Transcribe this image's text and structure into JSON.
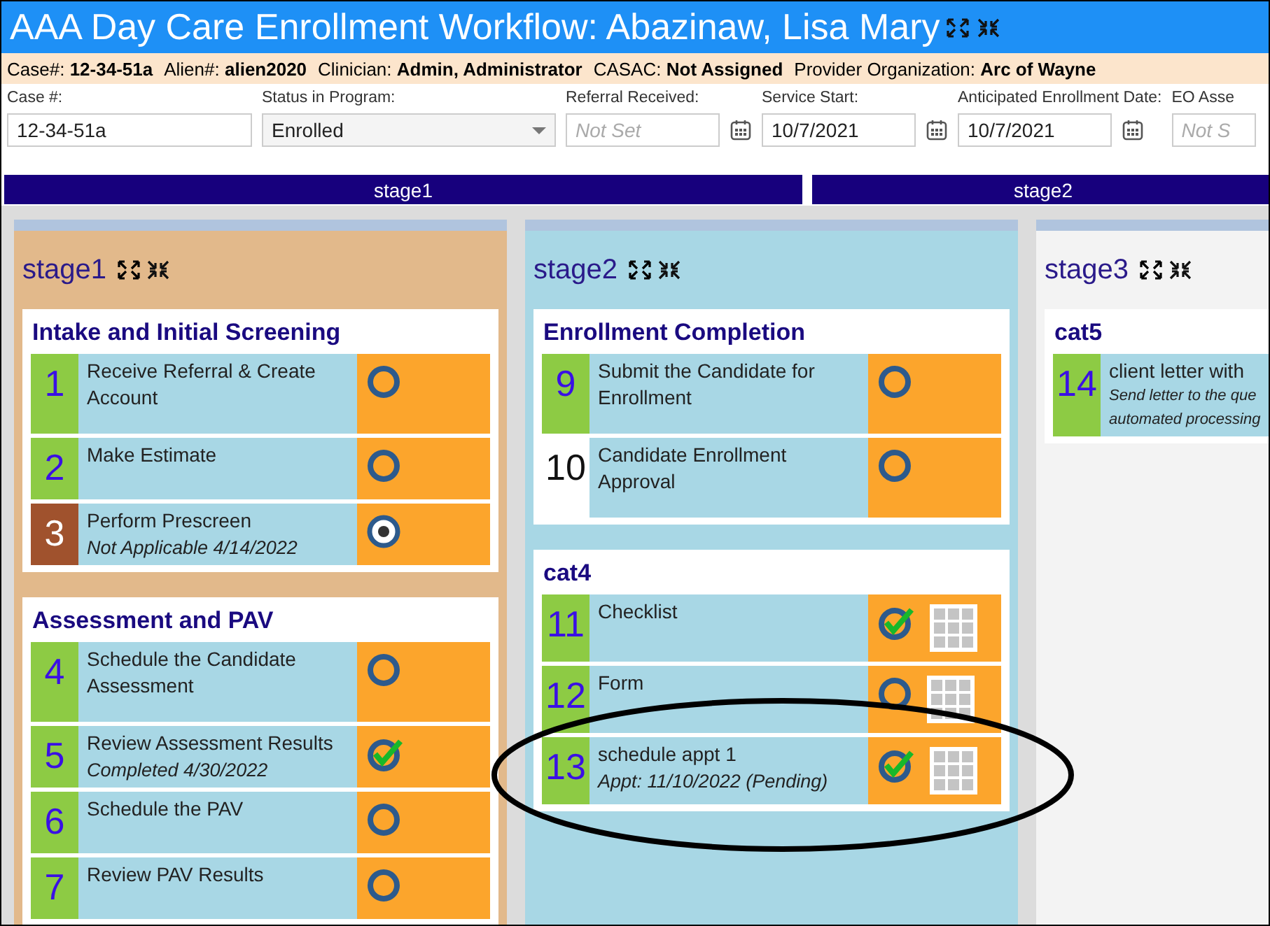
{
  "window": {
    "title": "AAA Day Care Enrollment Workflow: Abazinaw, Lisa Mary"
  },
  "info_bar": [
    {
      "label": "Case#:",
      "value": "12-34-51a"
    },
    {
      "label": "Alien#:",
      "value": "alien2020"
    },
    {
      "label": "Clinician:",
      "value": "Admin, Administrator"
    },
    {
      "label": "CASAC:",
      "value": "Not Assigned"
    },
    {
      "label": "Provider Organization:",
      "value": "Arc of Wayne"
    }
  ],
  "fields": [
    {
      "kind": "text",
      "label": "Case #:",
      "value": "12-34-51a"
    },
    {
      "kind": "dropdown",
      "label": "Status in Program:",
      "value": "Enrolled"
    },
    {
      "kind": "date",
      "label": "Referral Received:",
      "placeholder": "Not Set"
    },
    {
      "kind": "date",
      "label": "Service Start:",
      "value": "10/7/2021"
    },
    {
      "kind": "date",
      "label": "Anticipated Enrollment Date:",
      "value": "10/7/2021"
    },
    {
      "kind": "text",
      "label": "EO Asse",
      "placeholder": "Not S"
    }
  ],
  "stage_bars": [
    {
      "label": "stage1"
    },
    {
      "label": "stage2"
    }
  ],
  "stages": [
    {
      "title": "stage1",
      "color": "#e2b98b",
      "categories": [
        {
          "title": "Intake and Initial Screening",
          "tasks": [
            {
              "number": "1",
              "color": "#8dcb44",
              "title": "Receive Referral & Create Account",
              "kind": "open",
              "grid": false
            },
            {
              "number": "2",
              "color": "#8dcb44",
              "title": "Make Estimate",
              "kind": "open",
              "grid": false
            },
            {
              "number": "3",
              "color": "#a0522d",
              "title": "Perform Prescreen",
              "note": "Not Applicable 4/14/2022",
              "kind": "na",
              "grid": false
            }
          ]
        },
        {
          "title": "Assessment and PAV",
          "tasks": [
            {
              "number": "4",
              "color": "#8dcb44",
              "title": "Schedule the Candidate Assessment",
              "kind": "open",
              "grid": false
            },
            {
              "number": "5",
              "color": "#8dcb44",
              "title": "Review Assessment Results",
              "note": "Completed 4/30/2022",
              "kind": "done",
              "grid": false
            },
            {
              "number": "6",
              "color": "#8dcb44",
              "title": "Schedule the PAV",
              "kind": "open",
              "grid": false
            },
            {
              "number": "7",
              "color": "#8dcb44",
              "title": "Review PAV Results",
              "kind": "open",
              "grid": false
            }
          ]
        }
      ]
    },
    {
      "title": "stage2",
      "color": "#a8d7e5",
      "categories": [
        {
          "title": "Enrollment Completion",
          "tasks": [
            {
              "number": "9",
              "color": "#8dcb44",
              "title": "Submit the Candidate for Enrollment",
              "kind": "open",
              "grid": false
            },
            {
              "number": "10",
              "color": "#ffffff",
              "title": "Candidate Enrollment Approval",
              "kind": "open",
              "grid": false
            }
          ]
        },
        {
          "title": "cat4",
          "tasks": [
            {
              "number": "11",
              "color": "#8dcb44",
              "title": "Checklist",
              "kind": "done",
              "grid": true
            },
            {
              "number": "12",
              "color": "#8dcb44",
              "title": "Form",
              "kind": "open",
              "grid": true
            },
            {
              "number": "13",
              "color": "#8dcb44",
              "title": "schedule appt 1",
              "note": "Appt: 11/10/2022 (Pending)",
              "kind": "done",
              "grid": true
            }
          ]
        }
      ]
    },
    {
      "title": "stage3",
      "color": "#f3f3f3",
      "categories": [
        {
          "title": "cat5",
          "tasks": [
            {
              "number": "14",
              "color": "#8dcb44",
              "title": "client letter with",
              "note_lines": [
                "Send letter to the que",
                "automated processing"
              ],
              "kind": "none"
            }
          ]
        }
      ]
    }
  ]
}
